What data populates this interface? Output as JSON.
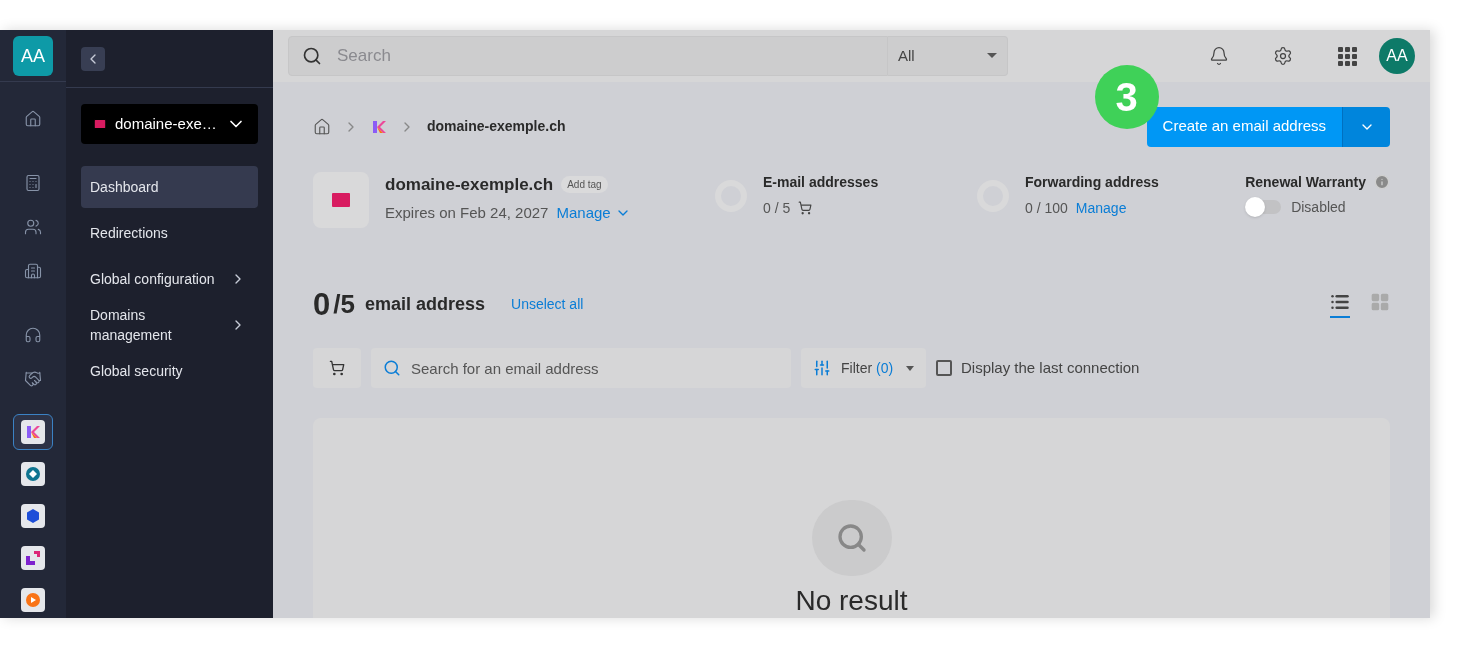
{
  "rail": {
    "avatar": "AA",
    "apps": [
      {
        "selected": true
      },
      {
        "selected": false
      },
      {
        "selected": false
      },
      {
        "selected": false
      },
      {
        "selected": false
      }
    ]
  },
  "sidebar": {
    "domain_select": "domaine-exe…",
    "items": [
      {
        "label": "Dashboard",
        "selected": true,
        "has_submenu": false
      },
      {
        "label": "Redirections",
        "selected": false,
        "has_submenu": false
      },
      {
        "label": "Global configuration",
        "selected": false,
        "has_submenu": true
      },
      {
        "label": "Domains management",
        "selected": false,
        "has_submenu": true
      },
      {
        "label": "Global security",
        "selected": false,
        "has_submenu": false
      }
    ]
  },
  "topbar": {
    "search_placeholder": "Search",
    "scope": "All",
    "avatar": "AA"
  },
  "breadcrumb": {
    "current": "domaine-exemple.ch"
  },
  "step_badge": "3",
  "create_button": "Create an email address",
  "domain": {
    "name": "domaine-exemple.ch",
    "tag": "Add tag",
    "expiry": "Expires on Feb 24, 2027",
    "manage": "Manage"
  },
  "stats": [
    {
      "kind": "cart",
      "title": "E-mail addresses",
      "value": "0 / 5"
    },
    {
      "kind": "link",
      "title": "Forwarding address",
      "value": "0 / 100",
      "link": "Manage"
    }
  ],
  "renewal": {
    "title": "Renewal Warranty",
    "on": false,
    "status": "Disabled"
  },
  "list": {
    "count": "0",
    "total": "/5",
    "label": "email address",
    "unselect": "Unselect all",
    "views": [
      {
        "kind": "list",
        "selected": true
      },
      {
        "kind": "grid",
        "selected": false
      }
    ]
  },
  "toolbar": {
    "search_placeholder": "Search for an email address",
    "filter_label": "Filter",
    "filter_count": "(0)",
    "last_connection": {
      "label": "Display the last connection",
      "checked": false
    }
  },
  "empty": {
    "message": "No result"
  }
}
